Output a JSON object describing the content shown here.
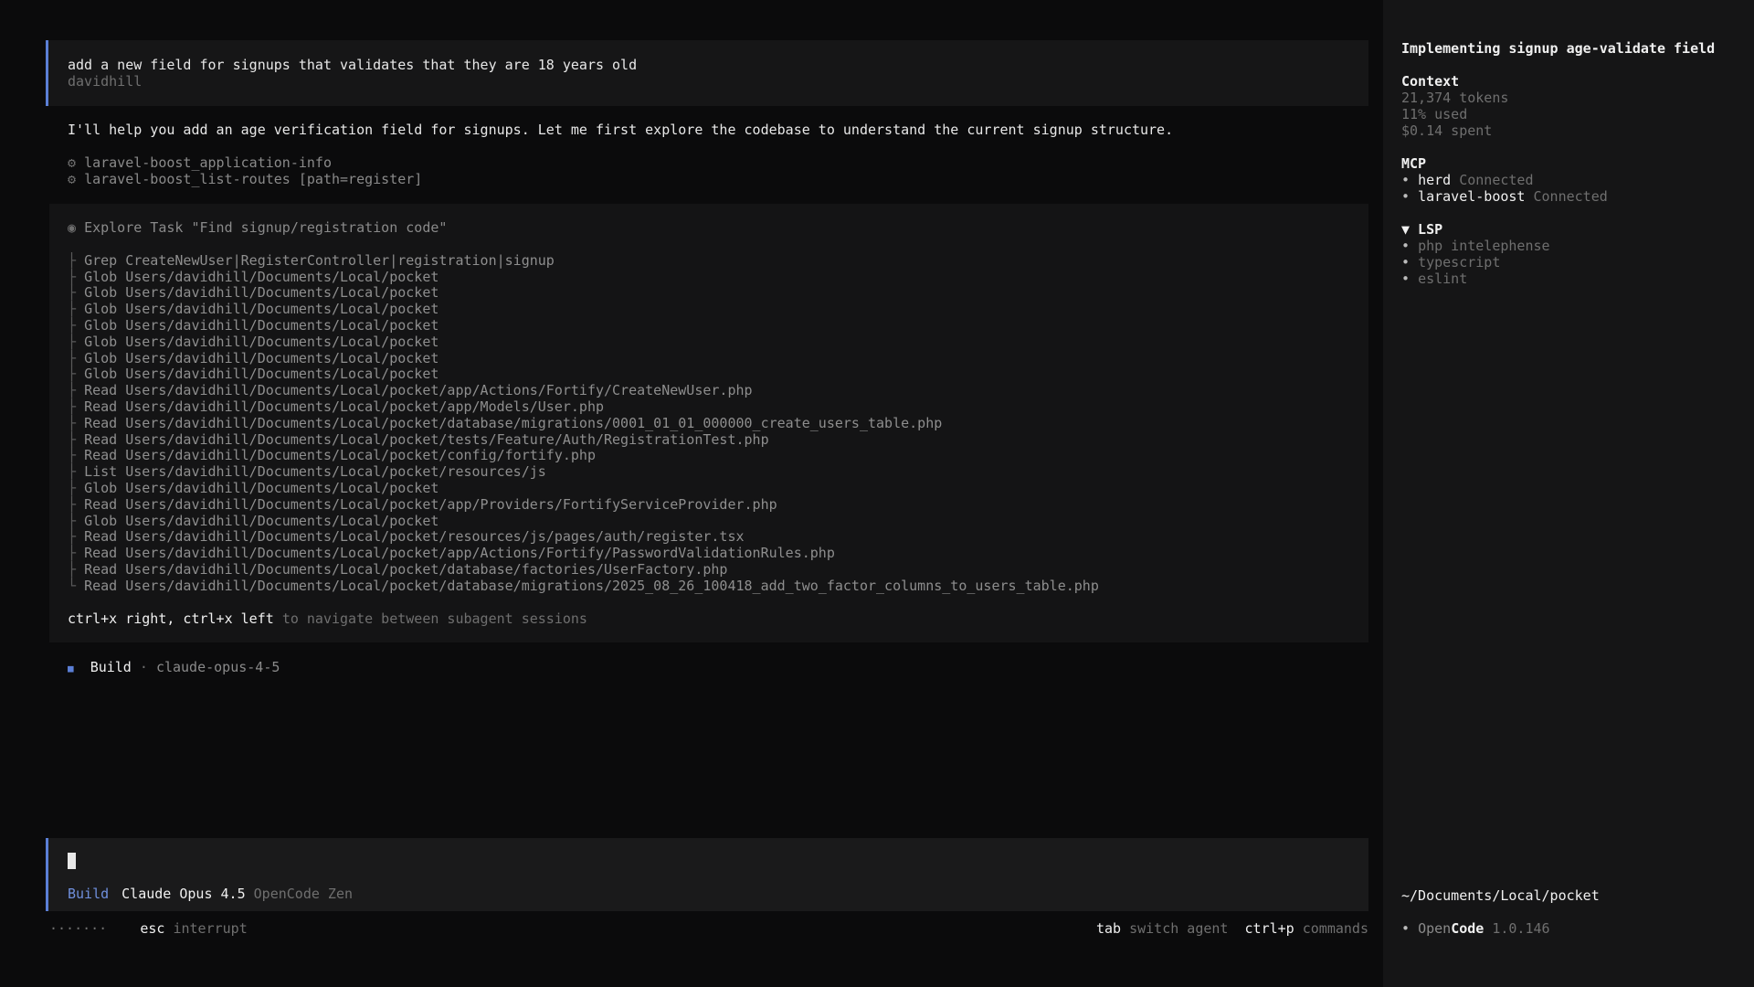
{
  "conversation": {
    "user_message": "add a new field for signups that validates that they are 18 years old",
    "user_name": "davidhill",
    "assistant_text": "I'll help you add an age verification field for signups. Let me first explore the codebase to understand the current signup structure.",
    "tools": [
      "laravel-boost_application-info",
      "laravel-boost_list-routes [path=register]"
    ],
    "task": {
      "title": "Explore Task \"Find signup/registration code\"",
      "lines": [
        "Grep CreateNewUser|RegisterController|registration|signup",
        "Glob Users/davidhill/Documents/Local/pocket",
        "Glob Users/davidhill/Documents/Local/pocket",
        "Glob Users/davidhill/Documents/Local/pocket",
        "Glob Users/davidhill/Documents/Local/pocket",
        "Glob Users/davidhill/Documents/Local/pocket",
        "Glob Users/davidhill/Documents/Local/pocket",
        "Glob Users/davidhill/Documents/Local/pocket",
        "Read Users/davidhill/Documents/Local/pocket/app/Actions/Fortify/CreateNewUser.php",
        "Read Users/davidhill/Documents/Local/pocket/app/Models/User.php",
        "Read Users/davidhill/Documents/Local/pocket/database/migrations/0001_01_01_000000_create_users_table.php",
        "Read Users/davidhill/Documents/Local/pocket/tests/Feature/Auth/RegistrationTest.php",
        "Read Users/davidhill/Documents/Local/pocket/config/fortify.php",
        "List Users/davidhill/Documents/Local/pocket/resources/js",
        "Glob Users/davidhill/Documents/Local/pocket",
        "Read Users/davidhill/Documents/Local/pocket/app/Providers/FortifyServiceProvider.php",
        "Glob Users/davidhill/Documents/Local/pocket",
        "Read Users/davidhill/Documents/Local/pocket/resources/js/pages/auth/register.tsx",
        "Read Users/davidhill/Documents/Local/pocket/app/Actions/Fortify/PasswordValidationRules.php",
        "Read Users/davidhill/Documents/Local/pocket/database/factories/UserFactory.php",
        "Read Users/davidhill/Documents/Local/pocket/database/migrations/2025_08_26_100418_add_two_factor_columns_to_users_table.php"
      ],
      "footer_keys": "ctrl+x right, ctrl+x left",
      "footer_text": "to navigate between subagent sessions"
    },
    "build": {
      "label": "Build",
      "separator": "·",
      "model": "claude-opus-4-5"
    }
  },
  "prompt": {
    "mode": "Build",
    "model_name": "Claude Opus 4.5",
    "provider": "OpenCode Zen"
  },
  "status": {
    "progress": "·······",
    "esc_key": "esc",
    "esc_label": "interrupt",
    "tab_key": "tab",
    "tab_label": "switch agent",
    "cmd_key": "ctrl+p",
    "cmd_label": "commands"
  },
  "sidebar": {
    "title": "Implementing signup age-validate field",
    "context": {
      "heading": "Context",
      "tokens": "21,374 tokens",
      "used": "11% used",
      "spent": "$0.14 spent"
    },
    "mcp": {
      "heading": "MCP",
      "items": [
        {
          "name": "herd",
          "status": "Connected"
        },
        {
          "name": "laravel-boost",
          "status": "Connected"
        }
      ]
    },
    "lsp": {
      "heading": "▼ LSP",
      "items": [
        "php intelephense",
        "typescript",
        "eslint"
      ]
    },
    "path": "~/Documents/Local/pocket",
    "app_open": "Open",
    "app_code": "Code",
    "version": "1.0.146"
  },
  "colors": {
    "accent": "#5b7fd6",
    "background": "#0b0b0c",
    "sidebar_bg": "#151516"
  }
}
